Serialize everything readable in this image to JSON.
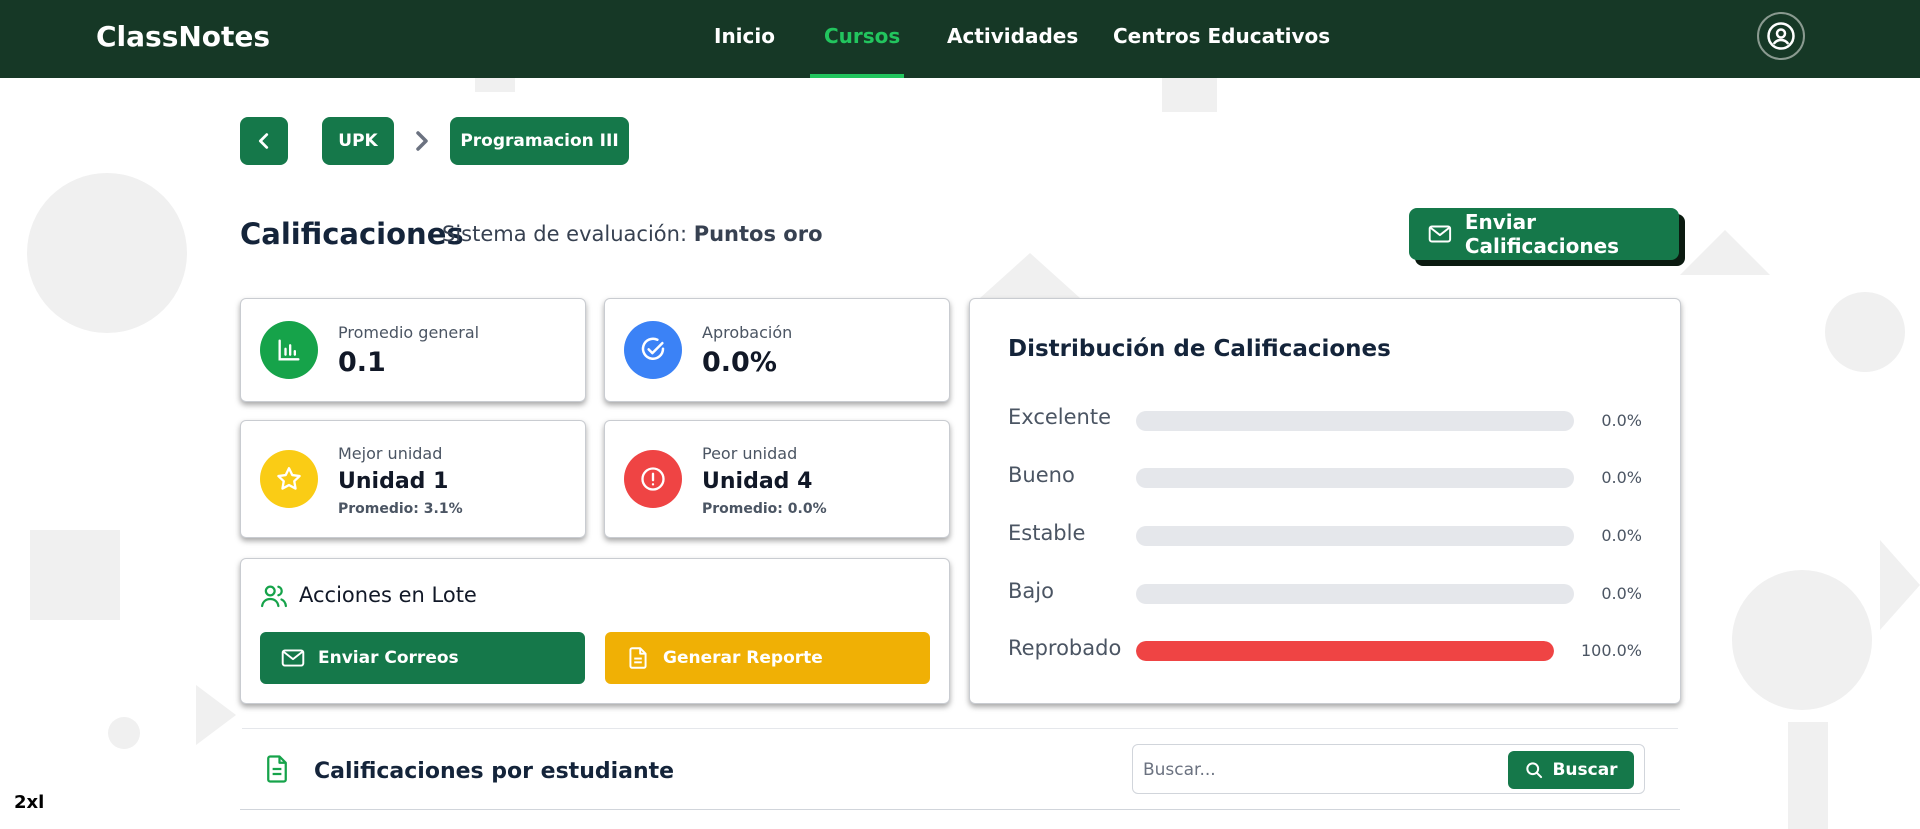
{
  "app": {
    "brand": "ClassNotes"
  },
  "nav": {
    "items": [
      {
        "label": "Inicio",
        "active": false
      },
      {
        "label": "Cursos",
        "active": true
      },
      {
        "label": "Actividades",
        "active": false
      },
      {
        "label": "Centros Educativos",
        "active": false
      }
    ]
  },
  "breadcrumb": {
    "items": [
      "UPK",
      "Programacion III"
    ]
  },
  "header": {
    "title": "Calificaciones",
    "eval_prefix": "Sistema de evaluación:",
    "eval_value": "Puntos oro",
    "send_button": "Enviar Calificaciones"
  },
  "stats": {
    "average": {
      "label": "Promedio general",
      "value": "0.1",
      "icon": "chart-bar-icon",
      "color": "#16a34a"
    },
    "approval": {
      "label": "Aprobación",
      "value": "0.0%",
      "icon": "check-circle-icon",
      "color": "#3b82f6"
    },
    "best": {
      "label": "Mejor unidad",
      "value": "Unidad 1",
      "sub": "Promedio: 3.1%",
      "icon": "star-icon",
      "color": "#facc15"
    },
    "worst": {
      "label": "Peor unidad",
      "value": "Unidad 4",
      "sub": "Promedio: 0.0%",
      "icon": "alert-circle-icon",
      "color": "#ef4444"
    }
  },
  "batch": {
    "title": "Acciones en Lote",
    "send_emails": "Enviar Correos",
    "generate_report": "Generar Reporte",
    "send_color": "#15784a",
    "report_color": "#f0b005"
  },
  "distribution": {
    "title": "Distribución de Calificaciones",
    "rows": [
      {
        "label": "Excelente",
        "value": 0.0,
        "text": "0.0%"
      },
      {
        "label": "Bueno",
        "value": 0.0,
        "text": "0.0%"
      },
      {
        "label": "Estable",
        "value": 0.0,
        "text": "0.0%"
      },
      {
        "label": "Bajo",
        "value": 0.0,
        "text": "0.0%"
      },
      {
        "label": "Reprobado",
        "value": 100.0,
        "text": "100.0%"
      }
    ]
  },
  "students": {
    "title": "Calificaciones por estudiante",
    "search_placeholder": "Buscar...",
    "search_button": "Buscar"
  },
  "breakpoint_label": "2xl",
  "colors": {
    "navbar": "#163826",
    "primary": "#15784a",
    "accent": "#22c55e",
    "danger": "#ef4444"
  }
}
